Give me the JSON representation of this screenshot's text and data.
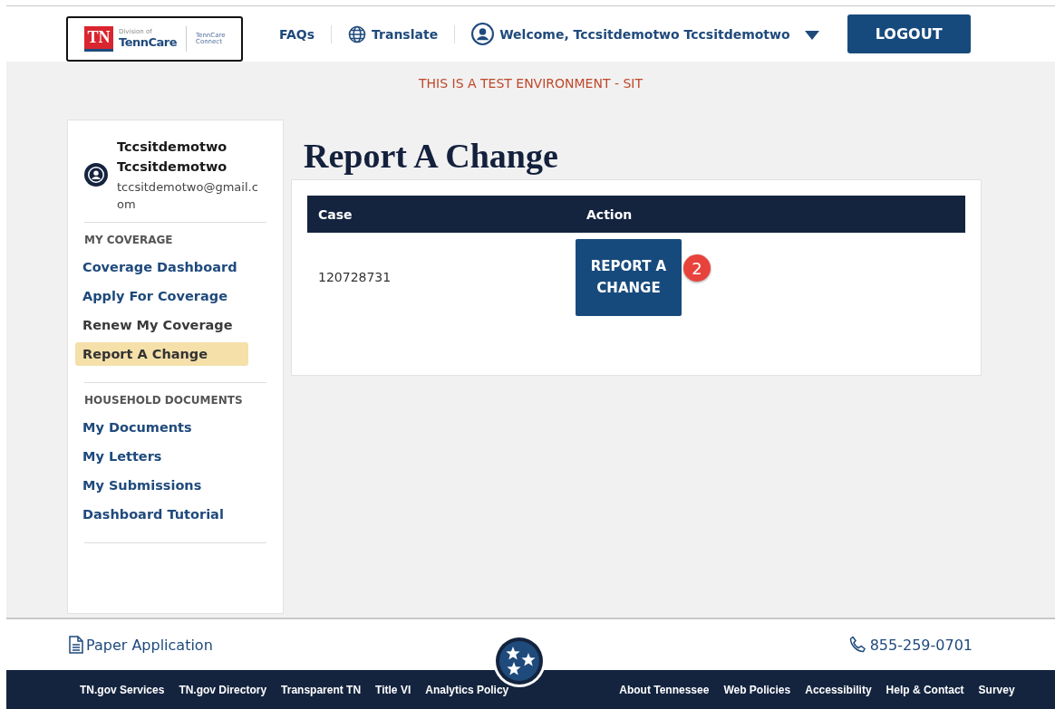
{
  "header": {
    "logo": {
      "badge": "TN",
      "division": "Division of",
      "brand": "TennCare",
      "product_line1": "TennCare",
      "product_line2": "Connect"
    },
    "nav": [
      {
        "kind": "link",
        "label": "FAQs"
      },
      {
        "kind": "translate",
        "label": "Translate"
      },
      {
        "kind": "user",
        "label": "Welcome, Tccsitdemotwo Tccsitdemotwo"
      }
    ],
    "logout": "LOGOUT"
  },
  "banner": "THIS IS A TEST ENVIRONMENT - SIT",
  "sidebar": {
    "user": {
      "name": "Tccsitdemotwo Tccsitdemotwo",
      "email": "tccsitdemotwo@gmail.com"
    },
    "sections": [
      {
        "heading": "MY COVERAGE",
        "items": [
          {
            "label": "Coverage Dashboard",
            "selected": false,
            "visited": false
          },
          {
            "label": "Apply For Coverage",
            "selected": false,
            "visited": false
          },
          {
            "label": "Renew My Coverage",
            "selected": false,
            "visited": true
          },
          {
            "label": "Report A Change",
            "selected": true,
            "visited": false
          }
        ]
      },
      {
        "heading": "HOUSEHOLD DOCUMENTS",
        "items": [
          {
            "label": "My Documents",
            "selected": false,
            "visited": false
          },
          {
            "label": "My Letters",
            "selected": false,
            "visited": false
          },
          {
            "label": "My Submissions",
            "selected": false,
            "visited": false
          },
          {
            "label": "Dashboard Tutorial",
            "selected": false,
            "visited": false
          }
        ]
      }
    ]
  },
  "page_title": "Report A Change",
  "table": {
    "columns": [
      "Case",
      "Action"
    ],
    "rows": [
      {
        "case": "120728731",
        "action": "REPORT A CHANGE",
        "step_badge": "2"
      }
    ]
  },
  "footer": {
    "paper_application": "Paper Application",
    "phone": "855-259-0701",
    "links_left": [
      "TN.gov Services",
      "TN.gov Directory",
      "Transparent TN",
      "Title VI",
      "Analytics Policy"
    ],
    "links_right": [
      "About Tennessee",
      "Web Policies",
      "Accessibility",
      "Help & Contact",
      "Survey"
    ]
  }
}
